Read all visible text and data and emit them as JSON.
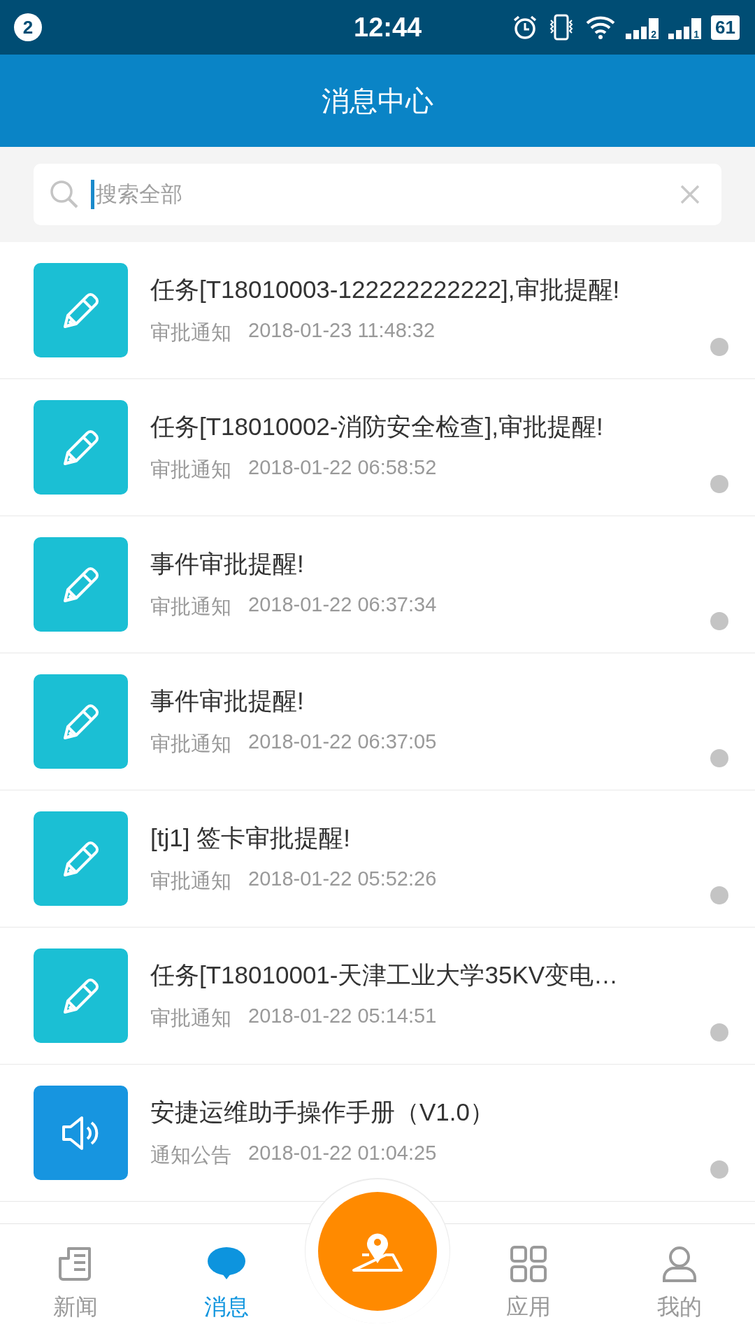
{
  "status_bar": {
    "notification_count": "2",
    "time": "12:44",
    "sim_1": "2",
    "sim_2": "1",
    "battery": "61"
  },
  "header": {
    "title": "消息中心"
  },
  "search": {
    "placeholder": "搜索全部"
  },
  "messages": [
    {
      "kind": "approval",
      "title": "任务[T18010003-122222222222],审批提醒!",
      "category": "审批通知",
      "time": "2018-01-23 11:48:32"
    },
    {
      "kind": "approval",
      "title": "任务[T18010002-消防安全检查],审批提醒!",
      "category": "审批通知",
      "time": "2018-01-22 06:58:52"
    },
    {
      "kind": "approval",
      "title": "事件审批提醒!",
      "category": "审批通知",
      "time": "2018-01-22 06:37:34"
    },
    {
      "kind": "approval",
      "title": "事件审批提醒!",
      "category": "审批通知",
      "time": "2018-01-22 06:37:05"
    },
    {
      "kind": "approval",
      "title": "[tj1] 签卡审批提醒!",
      "category": "审批通知",
      "time": "2018-01-22 05:52:26"
    },
    {
      "kind": "approval",
      "title": "任务[T18010001-天津工业大学35KV变电…",
      "category": "审批通知",
      "time": "2018-01-22 05:14:51"
    },
    {
      "kind": "notice",
      "title": "安捷运维助手操作手册（V1.0）",
      "category": "通知公告",
      "time": "2018-01-22 01:04:25"
    }
  ],
  "nav": [
    {
      "kind": "news",
      "label": "新闻",
      "selected": false
    },
    {
      "kind": "messages",
      "label": "消息",
      "selected": true
    },
    {
      "kind": "map"
    },
    {
      "kind": "apps",
      "label": "应用",
      "selected": false
    },
    {
      "kind": "profile",
      "label": "我的",
      "selected": false
    }
  ]
}
